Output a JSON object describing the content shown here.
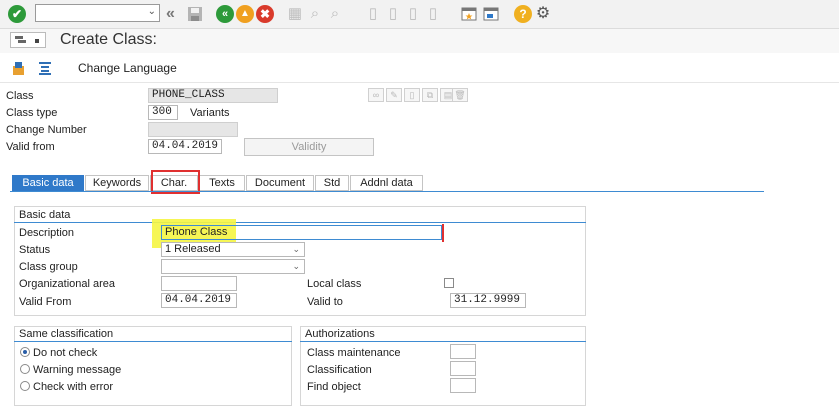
{
  "toolbar": {
    "command_field_value": "",
    "icons": [
      "enter-icon",
      "back-double-icon",
      "save-icon",
      "back-icon",
      "exit-icon",
      "cancel-icon",
      "print-icon",
      "find-icon",
      "find-next-icon",
      "first-page-icon",
      "previous-page-icon",
      "next-page-icon",
      "last-page-icon",
      "new-session-icon",
      "shortcut-icon",
      "help-icon",
      "settings-icon"
    ]
  },
  "title": {
    "text": "Create Class:"
  },
  "appbar": {
    "change_language": "Change Language"
  },
  "header": {
    "class_label": "Class",
    "class_value": "PHONE_CLASS",
    "class_type_label": "Class type",
    "class_type_value": "300",
    "variants": "Variants",
    "change_number_label": "Change Number",
    "change_number_value": "",
    "valid_from_label": "Valid from",
    "valid_from_value": "04.04.2019",
    "validity_button": "Validity"
  },
  "tabs": [
    {
      "label": "Basic data"
    },
    {
      "label": "Keywords"
    },
    {
      "label": "Char."
    },
    {
      "label": "Texts"
    },
    {
      "label": "Document"
    },
    {
      "label": "Std"
    },
    {
      "label": "Addnl data"
    }
  ],
  "basic_data": {
    "group_title": "Basic data",
    "description_label": "Description",
    "description_value": "Phone Class",
    "status_label": "Status",
    "status_value": "1 Released",
    "class_group_label": "Class group",
    "class_group_value": "",
    "org_area_label": "Organizational area",
    "org_area_value": "",
    "local_class_label": "Local class",
    "valid_from_label": "Valid From",
    "valid_from_value": "04.04.2019",
    "valid_to_label": "Valid to",
    "valid_to_value": "31.12.9999"
  },
  "same_classification": {
    "group_title": "Same classification",
    "options": [
      "Do not check",
      "Warning message",
      "Check with error"
    ],
    "selected": "Do not check"
  },
  "authorizations": {
    "group_title": "Authorizations",
    "items": [
      "Class maintenance",
      "Classification",
      "Find object"
    ]
  },
  "colors": {
    "accent_blue": "#2f79c9",
    "enter_green": "#2d9a3a",
    "orange": "#f0a020",
    "red": "#d93a2b",
    "highlight_yellow": "#f5f542",
    "annotation_red": "#e03030"
  }
}
